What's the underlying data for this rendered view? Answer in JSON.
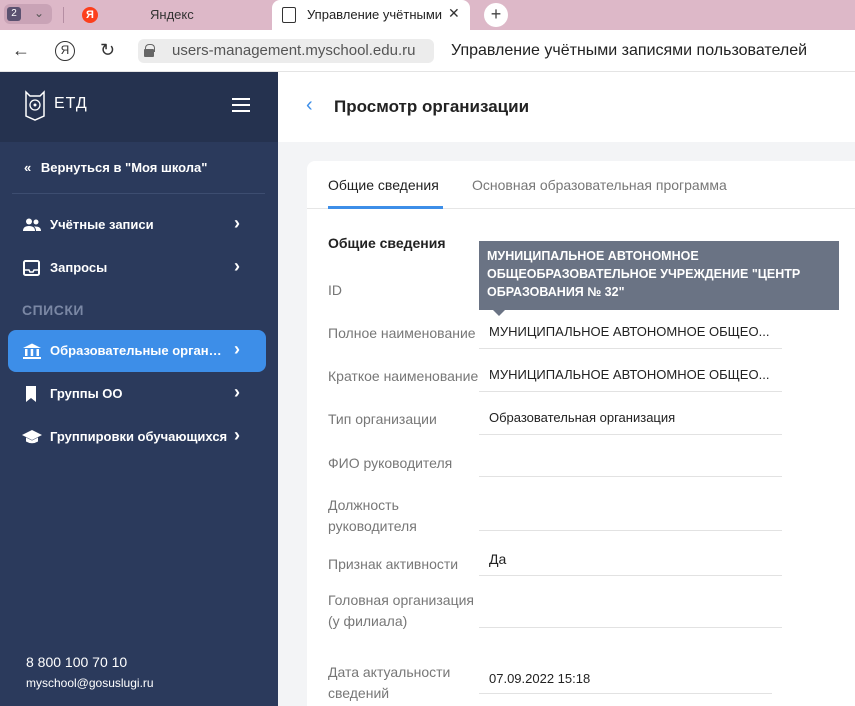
{
  "browser": {
    "tab_count": "2",
    "tabs": [
      {
        "label": "Яндекс"
      },
      {
        "label": "Управление учётными"
      }
    ],
    "url": "users-management.myschool.edu.ru",
    "page_title": "Управление учётными записями пользователей"
  },
  "sidebar": {
    "logo_text": "ЕТД",
    "back_link": "Вернуться в \"Моя школа\"",
    "items": [
      {
        "label": "Учётные записи",
        "icon": "users-icon"
      },
      {
        "label": "Запросы",
        "icon": "inbox-icon"
      }
    ],
    "section_label": "СПИСКИ",
    "list_items": [
      {
        "label": "Образовательные организации",
        "icon": "institution-icon",
        "active": true
      },
      {
        "label": "Группы ОО",
        "icon": "bookmark-icon"
      },
      {
        "label": "Группировки обучающихся",
        "icon": "graduation-cap-icon"
      }
    ],
    "phone": "8 800 100 70 10",
    "email": "myschool@gosuslugi.ru"
  },
  "main": {
    "title": "Просмотр организации",
    "tabs": [
      {
        "label": "Общие сведения",
        "active": true
      },
      {
        "label": "Основная образовательная программа",
        "active": false
      }
    ],
    "section_title": "Общие сведения",
    "tooltip": "МУНИЦИПАЛЬНОЕ АВТОНОМНОЕ ОБЩЕОБРАЗОВАТЕЛЬНОЕ УЧРЕЖДЕНИЕ \"ЦЕНТР ОБРАЗОВАНИЯ № 32\"",
    "fields": [
      {
        "label": "ID",
        "value": ""
      },
      {
        "label": "Полное наименование",
        "value": "МУНИЦИПАЛЬНОЕ АВТОНОМНОЕ ОБЩЕО..."
      },
      {
        "label": "Краткое наименование",
        "value": "МУНИЦИПАЛЬНОЕ АВТОНОМНОЕ ОБЩЕО..."
      },
      {
        "label": "Тип организации",
        "value": "Образовательная организация"
      },
      {
        "label": "ФИО руководителя",
        "value": ""
      },
      {
        "label_line1": "Должность",
        "label_line2": "руководителя",
        "value": ""
      },
      {
        "label": "Признак активности",
        "value": "Да"
      },
      {
        "label_line1": "Головная организация",
        "label_line2": "(у филиала)",
        "value": ""
      },
      {
        "label_line1": "Дата актуальности",
        "label_line2": "сведений",
        "value": "07.09.2022 15:18"
      }
    ]
  },
  "colors": {
    "sidebar_bg": "#2b3a5c",
    "accent": "#3d8ee8",
    "tooltip_bg": "#6a7384"
  }
}
